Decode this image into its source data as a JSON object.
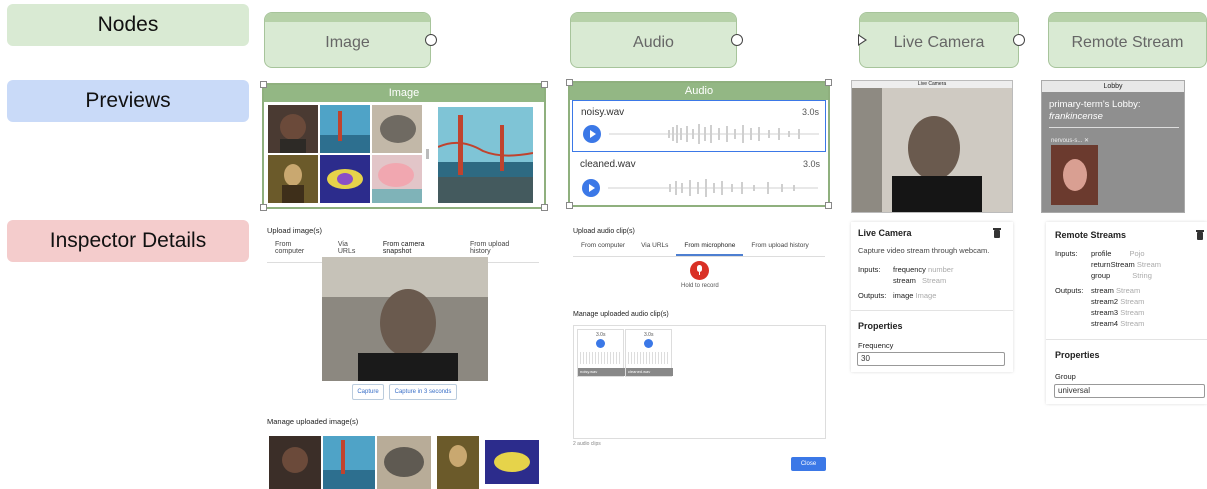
{
  "row_labels": {
    "nodes": "Nodes",
    "previews": "Previews",
    "inspector": "Inspector Details"
  },
  "nodes": {
    "image": "Image",
    "audio": "Audio",
    "live_camera": "Live Camera",
    "remote_stream": "Remote Stream"
  },
  "image_preview": {
    "header": "Image"
  },
  "audio_preview": {
    "header": "Audio",
    "clips": [
      {
        "name": "noisy.wav",
        "duration": "3.0s"
      },
      {
        "name": "cleaned.wav",
        "duration": "3.0s"
      }
    ]
  },
  "live_preview": {
    "header": "Live Camera"
  },
  "remote_preview": {
    "header": "Lobby",
    "title": "primary-term's Lobby:",
    "subtitle": "frankincense",
    "participant": "nervous-s..."
  },
  "image_inspector": {
    "upload_label": "Upload image(s)",
    "tabs": [
      "From computer",
      "Via URLs",
      "From camera snapshot",
      "From upload history"
    ],
    "capture": "Capture",
    "capture_delay": "Capture in 3 seconds",
    "manage_label": "Manage uploaded image(s)"
  },
  "audio_inspector": {
    "upload_label": "Upload audio clip(s)",
    "tabs": [
      "From computer",
      "Via URLs",
      "From microphone",
      "From upload history"
    ],
    "hold": "Hold to record",
    "manage_label": "Manage uploaded audio clip(s)",
    "clips": [
      {
        "duration": "3.0s",
        "name": "noisy.wav"
      },
      {
        "duration": "3.0s",
        "name": "cleaned.wav"
      }
    ],
    "count": "2 audio clips",
    "close": "Close"
  },
  "live_inspector": {
    "title": "Live Camera",
    "description": "Capture video stream through webcam.",
    "inputs_label": "Inputs:",
    "inputs": [
      {
        "name": "frequency",
        "type": "number"
      },
      {
        "name": "stream",
        "type": "Stream"
      }
    ],
    "outputs_label": "Outputs:",
    "outputs": [
      {
        "name": "image",
        "type": "Image"
      }
    ],
    "properties": "Properties",
    "freq_label": "Frequency",
    "freq_value": "30"
  },
  "remote_inspector": {
    "title": "Remote Streams",
    "inputs_label": "Inputs:",
    "inputs": [
      {
        "name": "profile",
        "type": "Pojo"
      },
      {
        "name": "returnStream",
        "type": "Stream"
      },
      {
        "name": "group",
        "type": "String"
      }
    ],
    "outputs_label": "Outputs:",
    "outputs": [
      {
        "name": "stream",
        "type": "Stream"
      },
      {
        "name": "stream2",
        "type": "Stream"
      },
      {
        "name": "stream3",
        "type": "Stream"
      },
      {
        "name": "stream4",
        "type": "Stream"
      }
    ],
    "properties": "Properties",
    "group_label": "Group",
    "group_value": "universal"
  },
  "colors": {
    "node_green": "#d9ead3",
    "header_green": "#93b784",
    "blue_label": "#c9daf8",
    "pink_label": "#f4cccc",
    "accent_blue": "#3b78e7",
    "record_red": "#d93025"
  }
}
